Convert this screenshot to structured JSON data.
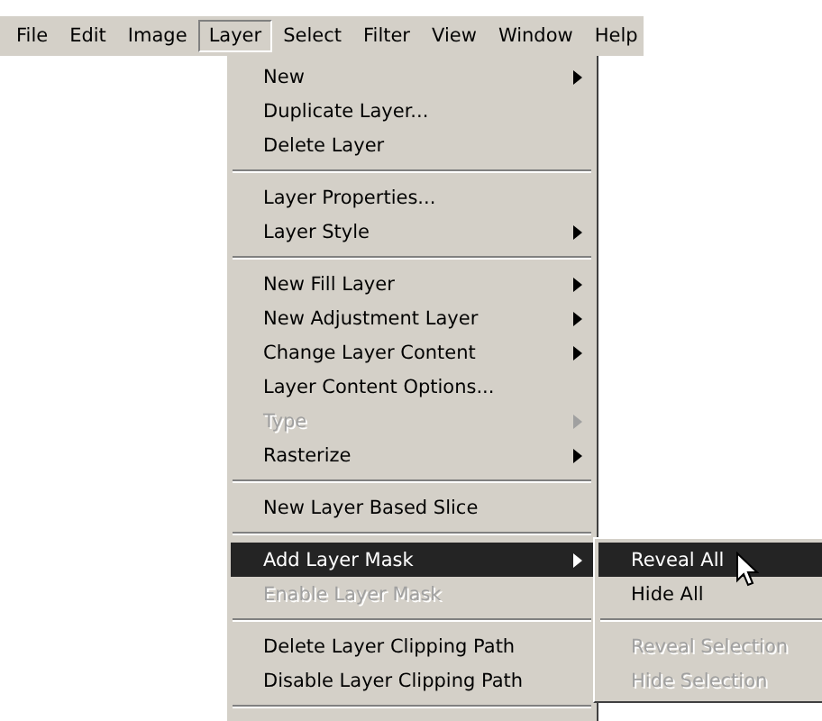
{
  "menubar": [
    {
      "label": "File",
      "selected": false
    },
    {
      "label": "Edit",
      "selected": false
    },
    {
      "label": "Image",
      "selected": false
    },
    {
      "label": "Layer",
      "selected": true
    },
    {
      "label": "Select",
      "selected": false
    },
    {
      "label": "Filter",
      "selected": false
    },
    {
      "label": "View",
      "selected": false
    },
    {
      "label": "Window",
      "selected": false
    },
    {
      "label": "Help",
      "selected": false
    }
  ],
  "menu": {
    "groups": [
      [
        {
          "label": "New",
          "disabled": false,
          "has_submenu": true,
          "selected": false
        },
        {
          "label": "Duplicate Layer...",
          "disabled": false,
          "has_submenu": false,
          "selected": false
        },
        {
          "label": "Delete Layer",
          "disabled": false,
          "has_submenu": false,
          "selected": false
        }
      ],
      [
        {
          "label": "Layer Properties...",
          "disabled": false,
          "has_submenu": false,
          "selected": false
        },
        {
          "label": "Layer Style",
          "disabled": false,
          "has_submenu": true,
          "selected": false
        }
      ],
      [
        {
          "label": "New Fill Layer",
          "disabled": false,
          "has_submenu": true,
          "selected": false
        },
        {
          "label": "New Adjustment Layer",
          "disabled": false,
          "has_submenu": true,
          "selected": false
        },
        {
          "label": "Change Layer Content",
          "disabled": false,
          "has_submenu": true,
          "selected": false
        },
        {
          "label": "Layer Content Options...",
          "disabled": false,
          "has_submenu": false,
          "selected": false
        },
        {
          "label": "Type",
          "disabled": true,
          "has_submenu": true,
          "selected": false
        },
        {
          "label": "Rasterize",
          "disabled": false,
          "has_submenu": true,
          "selected": false
        }
      ],
      [
        {
          "label": "New Layer Based Slice",
          "disabled": false,
          "has_submenu": false,
          "selected": false
        }
      ],
      [
        {
          "label": "Add Layer Mask",
          "disabled": false,
          "has_submenu": true,
          "selected": true,
          "submenu": {
            "groups": [
              [
                {
                  "label": "Reveal All",
                  "disabled": false,
                  "selected": true
                },
                {
                  "label": "Hide All",
                  "disabled": false,
                  "selected": false
                }
              ],
              [
                {
                  "label": "Reveal Selection",
                  "disabled": true,
                  "selected": false
                },
                {
                  "label": "Hide Selection",
                  "disabled": true,
                  "selected": false
                }
              ]
            ]
          }
        },
        {
          "label": "Enable Layer Mask",
          "disabled": true,
          "has_submenu": false,
          "selected": false
        }
      ],
      [
        {
          "label": "Delete Layer Clipping Path",
          "disabled": false,
          "has_submenu": false,
          "selected": false
        },
        {
          "label": "Disable Layer Clipping Path",
          "disabled": false,
          "has_submenu": false,
          "selected": false
        }
      ]
    ]
  }
}
